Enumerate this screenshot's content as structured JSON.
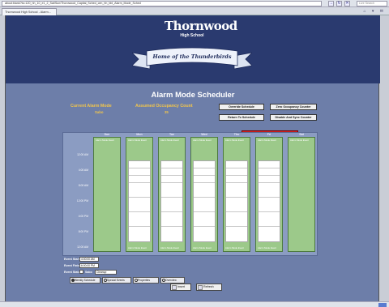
{
  "browser": {
    "address": "about:blank?ts=120_hh_10_e1_2_Sat/Sun/Thorowood_Capital_Sched_cen_hh_bbl_Alarm_Mode_Sched",
    "search_placeholder": "Live Search",
    "tab_title": "Thornwood High School - Alarm...",
    "toolbar_icons": "⌂ ▾ ✉"
  },
  "banner": {
    "logo_text": "Thornwood",
    "logo_subtitle": "High School",
    "ribbon_text": "Home of the Thunderbirds"
  },
  "page": {
    "title": "Alarm Mode Scheduler",
    "current_alarm_mode_label": "Current Alarm Mode",
    "current_alarm_mode_value": "Sabo",
    "assumed_occupancy_label": "Assumed Occupancy Count",
    "assumed_occupancy_value": "35",
    "buttons": {
      "override_schedule": "Override Schedule",
      "zero_occupancy": "Zero Occupancy Counter",
      "return_to_schedule": "Return To Schedule",
      "disable_sync": "Disable And Sync Counter"
    },
    "red_panel": {
      "line1": "OVERRIDE IS ACTIVE",
      "line2": "ALL EVENTS DISABLED"
    }
  },
  "schedule": {
    "days": [
      "Sun",
      "Mon",
      "Tue",
      "Wed",
      "Thu",
      "Fri",
      "Sat"
    ],
    "time_labels": [
      "12:00 AM",
      "4:00 AM",
      "8:00 AM",
      "12:00 PM",
      "4:00 PM",
      "8:00 PM",
      "12:00 AM"
    ],
    "day_top_labels": [
      "Alarm Mode Event",
      "Alarm Mode Event",
      "Alarm Mode Event",
      "Alarm Mode Event",
      "Alarm Mode Event",
      "Alarm Mode Event",
      "Alarm Mode Event"
    ],
    "day_bottom_labels": [
      "",
      "Alarm Mode Event",
      "Alarm Mode Event",
      "Alarm Mode Event",
      "Alarm Mode Event",
      "Alarm Mode Event",
      ""
    ]
  },
  "form": {
    "event_start_label": "Event Start",
    "event_start_value": "4:00:00 AM",
    "event_finish_label": "Event Finish",
    "event_finish_value": "6:00:00 PM",
    "event_status_label": "Event Status",
    "event_status_checkbox_label": "Sabo",
    "event_status_select": "Cleanup"
  },
  "tabs": {
    "weekly_schedule": "Weekly Schedule",
    "special_events": "Special Events",
    "properties": "Properties",
    "overview": "Overview"
  },
  "actions": {
    "insert": "Insert",
    "refresh": "Refresh"
  },
  "colors": {
    "banner": "#2a3a6f",
    "page_bg": "#6d7ea9",
    "accent_gold": "#f3c64a",
    "event_green": "#9cc98a",
    "override_red": "#d02020"
  }
}
